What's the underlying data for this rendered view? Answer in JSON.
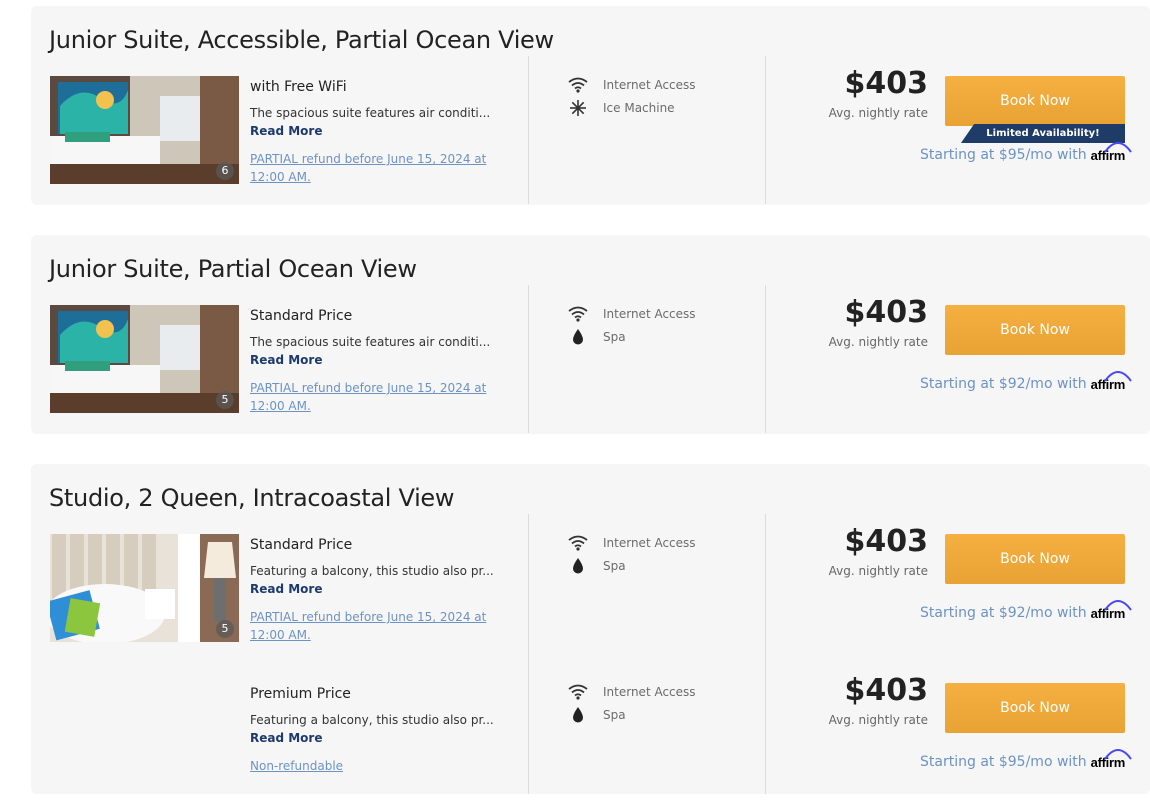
{
  "rooms": [
    {
      "title": "Junior Suite, Accessible, Partial Ocean View",
      "rates": [
        {
          "photo_count": "6",
          "name": "with Free WiFi",
          "description": "The spacious suite features air conditi...",
          "read_more": "Read More",
          "refund": "PARTIAL refund before June 15, 2024 at 12:00 AM.",
          "amenities": [
            {
              "label": "Internet Access",
              "icon": "wifi-icon"
            },
            {
              "label": "Ice Machine",
              "icon": "snowflake-icon"
            }
          ],
          "price": "$403",
          "price_label": "Avg. nightly rate",
          "book_label": "Book Now",
          "badge": "Limited Availability!",
          "affirm_text": "Starting at $95/mo with",
          "affirm_brand": "affirm"
        }
      ]
    },
    {
      "title": "Junior Suite, Partial Ocean View",
      "rates": [
        {
          "photo_count": "5",
          "name": "Standard Price",
          "description": "The spacious suite features air conditi...",
          "read_more": "Read More",
          "refund": "PARTIAL refund before June 15, 2024 at 12:00 AM.",
          "amenities": [
            {
              "label": "Internet Access",
              "icon": "wifi-icon"
            },
            {
              "label": "Spa",
              "icon": "drop-icon"
            }
          ],
          "price": "$403",
          "price_label": "Avg. nightly rate",
          "book_label": "Book Now",
          "affirm_text": "Starting at $92/mo with",
          "affirm_brand": "affirm"
        }
      ]
    },
    {
      "title": "Studio, 2 Queen, Intracoastal View",
      "rates": [
        {
          "photo_count": "5",
          "name": "Standard Price",
          "description": "Featuring a balcony, this studio also pr...",
          "read_more": "Read More",
          "refund": "PARTIAL refund before June 15, 2024 at 12:00 AM.",
          "amenities": [
            {
              "label": "Internet Access",
              "icon": "wifi-icon"
            },
            {
              "label": "Spa",
              "icon": "drop-icon"
            }
          ],
          "price": "$403",
          "price_label": "Avg. nightly rate",
          "book_label": "Book Now",
          "affirm_text": "Starting at $92/mo with",
          "affirm_brand": "affirm"
        },
        {
          "name": "Premium Price",
          "description": "Featuring a balcony, this studio also pr...",
          "read_more": "Read More",
          "refund": "Non-refundable",
          "amenities": [
            {
              "label": "Internet Access",
              "icon": "wifi-icon"
            },
            {
              "label": "Spa",
              "icon": "drop-icon"
            }
          ],
          "price": "$403",
          "price_label": "Avg. nightly rate",
          "book_label": "Book Now",
          "affirm_text": "Starting at $95/mo with",
          "affirm_brand": "affirm"
        }
      ]
    }
  ],
  "colors": {
    "card_bg": "#f6f6f6",
    "button": "#eda838",
    "badge": "#1f3b68",
    "link": "#6c93c4",
    "read_more": "#1d3a6e"
  }
}
